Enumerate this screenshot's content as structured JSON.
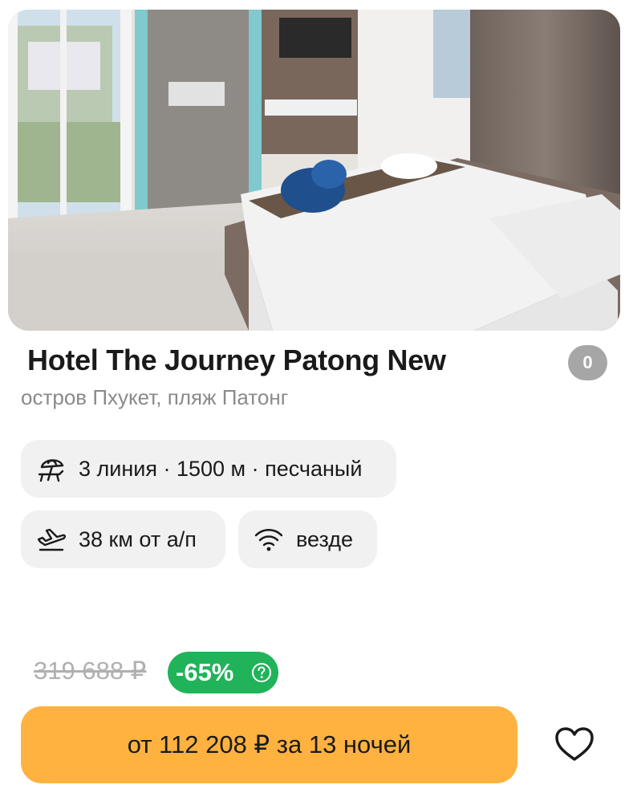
{
  "hotel": {
    "name": "Hotel The Journey Patong New",
    "rating": "0",
    "location": "остров Пхукет, пляж Патонг",
    "photo_icon": "hotel-room-photo"
  },
  "features": {
    "beach": {
      "icon": "beach-umbrella-icon",
      "text": "3 линия · 1500 м · песчаный"
    },
    "airport": {
      "icon": "airplane-icon",
      "text": "38 км от а/п"
    },
    "wifi": {
      "icon": "wifi-icon",
      "text": "везде"
    }
  },
  "price": {
    "old": "319 688 ₽",
    "discount": "-65%",
    "cta_label": "от 112 208 ₽ за 13 ночей"
  },
  "colors": {
    "cta": "#ffb23f",
    "discount": "#20b35a",
    "chip_bg": "#f1f1f1",
    "rating_bg": "#a6a6a6"
  },
  "favorite": {
    "icon": "heart-icon"
  }
}
